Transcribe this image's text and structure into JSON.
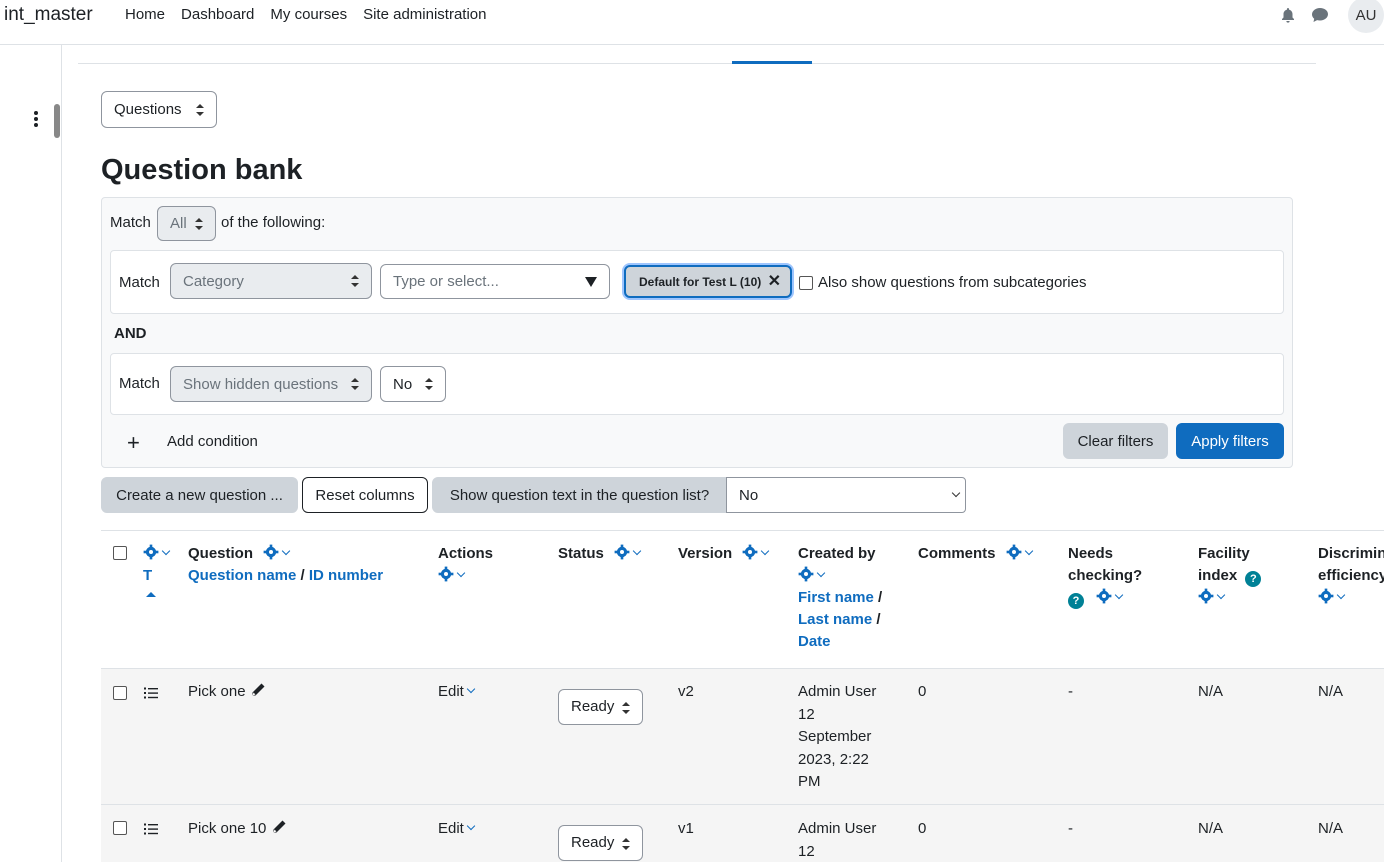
{
  "navbar": {
    "brand": "int_master",
    "links": [
      "Home",
      "Dashboard",
      "My courses",
      "Site administration"
    ],
    "avatar_initials": "AU"
  },
  "page_select": "Questions",
  "page_title": "Question bank",
  "filters": {
    "match_label": "Match",
    "match_value": "All",
    "of_following": "of the following:",
    "condition1": {
      "match_label": "Match",
      "type": "Category",
      "placeholder": "Type or select...",
      "chip": "Default for Test L (10)",
      "subcat_label": "Also show questions from subcategories"
    },
    "join": "AND",
    "condition2": {
      "match_label": "Match",
      "type": "Show hidden questions",
      "value": "No"
    },
    "add_condition": "Add condition",
    "clear": "Clear filters",
    "apply": "Apply filters"
  },
  "toolbar": {
    "create": "Create a new question ...",
    "reset": "Reset columns",
    "show_text_label": "Show question text in the question list?",
    "show_text_value": "No"
  },
  "columns": {
    "type_short": "T",
    "question": "Question",
    "question_name": "Question name",
    "id_number": "ID number",
    "actions": "Actions",
    "status": "Status",
    "version": "Version",
    "created_by": "Created by",
    "first_name": "First name",
    "last_name": "Last name",
    "date": "Date",
    "comments": "Comments",
    "needs_checking_1": "Needs",
    "needs_checking_2": "checking?",
    "facility_1": "Facility",
    "facility_2": "index",
    "discrim_1": "Discrimination",
    "discrim_2": "efficiency",
    "slash": "/"
  },
  "rows": [
    {
      "name": "Pick one",
      "action": "Edit",
      "status": "Ready",
      "version": "v2",
      "creator_lines": [
        "Admin User",
        "12",
        "September",
        "2023, 2:22",
        "PM"
      ],
      "comments": "0",
      "needs_checking": "-",
      "facility": "N/A",
      "discrimination": "N/A"
    },
    {
      "name": "Pick one 10",
      "action": "Edit",
      "status": "Ready",
      "version": "v1",
      "creator_lines": [
        "Admin User",
        "12"
      ],
      "comments": "0",
      "needs_checking": "-",
      "facility": "N/A",
      "discrimination": "N/A"
    }
  ],
  "colors": {
    "link": "#0f6cbf",
    "primary": "#0f6cbf",
    "help": "#008196"
  }
}
